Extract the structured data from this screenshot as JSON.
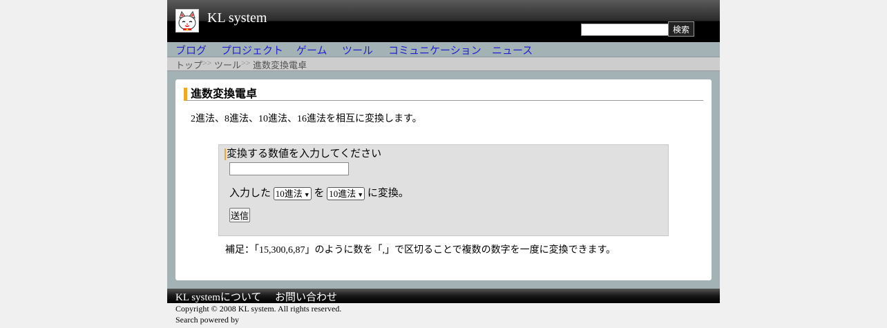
{
  "header": {
    "site_title": "KL system",
    "search": {
      "value": "",
      "placeholder": "",
      "button_label": "検索"
    },
    "logo_icon": "maneki-neko-cat-icon"
  },
  "nav": {
    "items": [
      {
        "label": "ブログ"
      },
      {
        "label": "プロジェクト"
      },
      {
        "label": "ゲーム"
      },
      {
        "label": "ツール"
      },
      {
        "label": "コミュニケーション"
      },
      {
        "label": "ニュース"
      }
    ]
  },
  "breadcrumb": {
    "items": [
      "トップ",
      "ツール",
      "進数変換電卓"
    ],
    "separator": ">>"
  },
  "main": {
    "title": "進数変換電卓",
    "description": "2進法、8進法、10進法、16進法を相互に変換します。",
    "form": {
      "prompt": "変換する数値を入力してください",
      "input_value": "",
      "text_before": "入力した",
      "from_base": "10進法",
      "text_middle": "を",
      "to_base": "10進法",
      "text_after": "に変換。",
      "submit_label": "送信"
    },
    "note": "補足：「15,300,6,87」のように数を「,」で区切ることで複数の数字を一度に変換できます。"
  },
  "footer": {
    "links": [
      {
        "label": "KL systemについて"
      },
      {
        "label": "お問い合わせ"
      }
    ],
    "copyright": "Copyright © 2008 KL system. All rights reserved.",
    "search_powered": "Search powered by"
  },
  "colors": {
    "accent": "#f5a623",
    "nav_link": "#1f1fcf",
    "nav_bg": "#a3b3b5",
    "header_bg": "#000000"
  }
}
